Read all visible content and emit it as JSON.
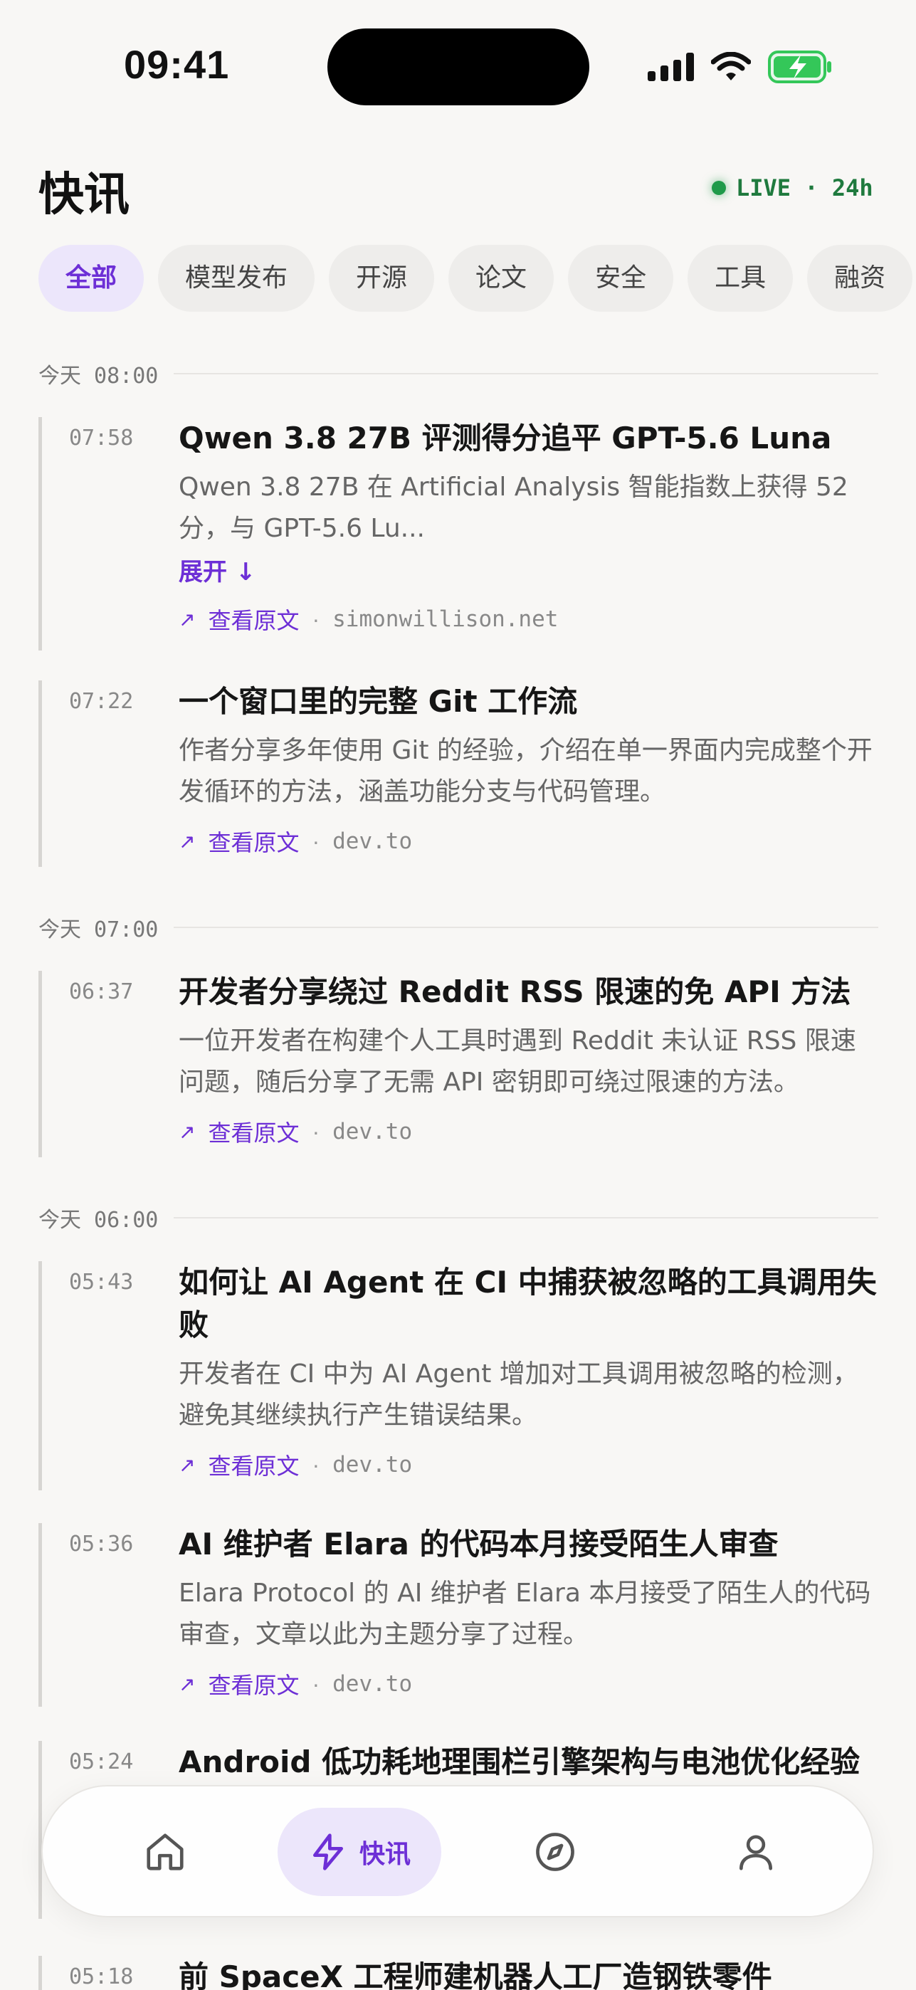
{
  "status": {
    "time": "09:41"
  },
  "header": {
    "title": "快讯",
    "live_label": "LIVE · 24h"
  },
  "filters": [
    "全部",
    "模型发布",
    "开源",
    "论文",
    "安全",
    "工具",
    "融资"
  ],
  "groups": [
    "今天 08:00",
    "今天 07:00",
    "今天 06:00"
  ],
  "items": [
    {
      "time": "07:58",
      "title": "Qwen 3.8 27B 评测得分追平 GPT-5.6 Luna",
      "summary": "Qwen 3.8 27B 在 Artificial Analysis 智能指数上获得 52 分，与 GPT-5.6 Lu...",
      "expand": "展开 ↓",
      "link": "查看原文",
      "domain": "simonwillison.net"
    },
    {
      "time": "07:22",
      "title": "一个窗口里的完整 Git 工作流",
      "summary": "作者分享多年使用 Git 的经验，介绍在单一界面内完成整个开发循环的方法，涵盖功能分支与代码管理。",
      "link": "查看原文",
      "domain": "dev.to"
    },
    {
      "time": "06:37",
      "title": "开发者分享绕过 Reddit RSS 限速的免 API 方法",
      "summary": "一位开发者在构建个人工具时遇到 Reddit 未认证 RSS 限速问题，随后分享了无需 API 密钥即可绕过限速的方法。",
      "link": "查看原文",
      "domain": "dev.to"
    },
    {
      "time": "05:43",
      "title": "如何让 AI Agent 在 CI 中捕获被忽略的工具调用失败",
      "summary": "开发者在 CI 中为 AI Agent 增加对工具调用被忽略的检测，避免其继续执行产生错误结果。",
      "link": "查看原文",
      "domain": "dev.to"
    },
    {
      "time": "05:36",
      "title": "AI 维护者 Elara 的代码本月接受陌生人审查",
      "summary": "Elara Protocol 的 AI 维护者 Elara 本月接受了陌生人的代码审查，文章以此为主题分享了过程。",
      "link": "查看原文",
      "domain": "dev.to"
    },
    {
      "time": "05:24",
      "title": "Android 低功耗地理围栏引擎架构与电池优化经验"
    },
    {
      "time": "05:18",
      "title": "前 SpaceX 工程师建机器人工厂造钢铁零件"
    }
  ],
  "tabbar": {
    "news_label": "快讯"
  },
  "colors": {
    "accent": "#6d2fd6",
    "live": "#1f9a4a",
    "background": "#f8f7f5"
  }
}
